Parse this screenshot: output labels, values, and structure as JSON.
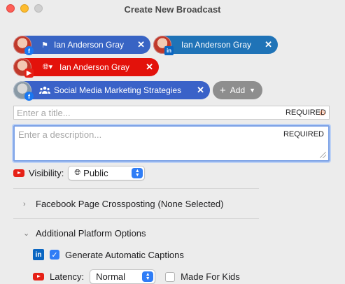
{
  "window": {
    "title": "Create New Broadcast"
  },
  "destinations": [
    {
      "name": "Ian Anderson Gray",
      "platform": "facebook",
      "kind_icon": "flag-icon"
    },
    {
      "name": "Ian Anderson Gray",
      "platform": "linkedin",
      "kind_icon": ""
    },
    {
      "name": "Ian Anderson Gray",
      "platform": "youtube",
      "kind_icon": "globe-dropdown-icon"
    },
    {
      "name": "Social Media Marketing Strategies",
      "platform": "facebook",
      "kind_icon": "group-icon"
    }
  ],
  "add_button": {
    "label": "Add"
  },
  "title_field": {
    "placeholder": "Enter a title...",
    "required_label": "REQUIRED"
  },
  "description_field": {
    "placeholder": "Enter a description...",
    "required_label": "REQUIRED"
  },
  "visibility": {
    "label": "Visibility:",
    "value": "Public"
  },
  "crossposting": {
    "label": "Facebook Page Crossposting",
    "status": "(None Selected)"
  },
  "additional": {
    "label": "Additional Platform Options"
  },
  "captions": {
    "label": "Generate Automatic Captions",
    "checked": true
  },
  "latency": {
    "label": "Latency:",
    "value": "Normal"
  },
  "kids": {
    "label": "Made For Kids",
    "checked": false
  },
  "colors": {
    "accent": "#2f7df6",
    "youtube": "#e3120b",
    "linkedin": "#1f73b7",
    "facebook": "#3864c4"
  }
}
